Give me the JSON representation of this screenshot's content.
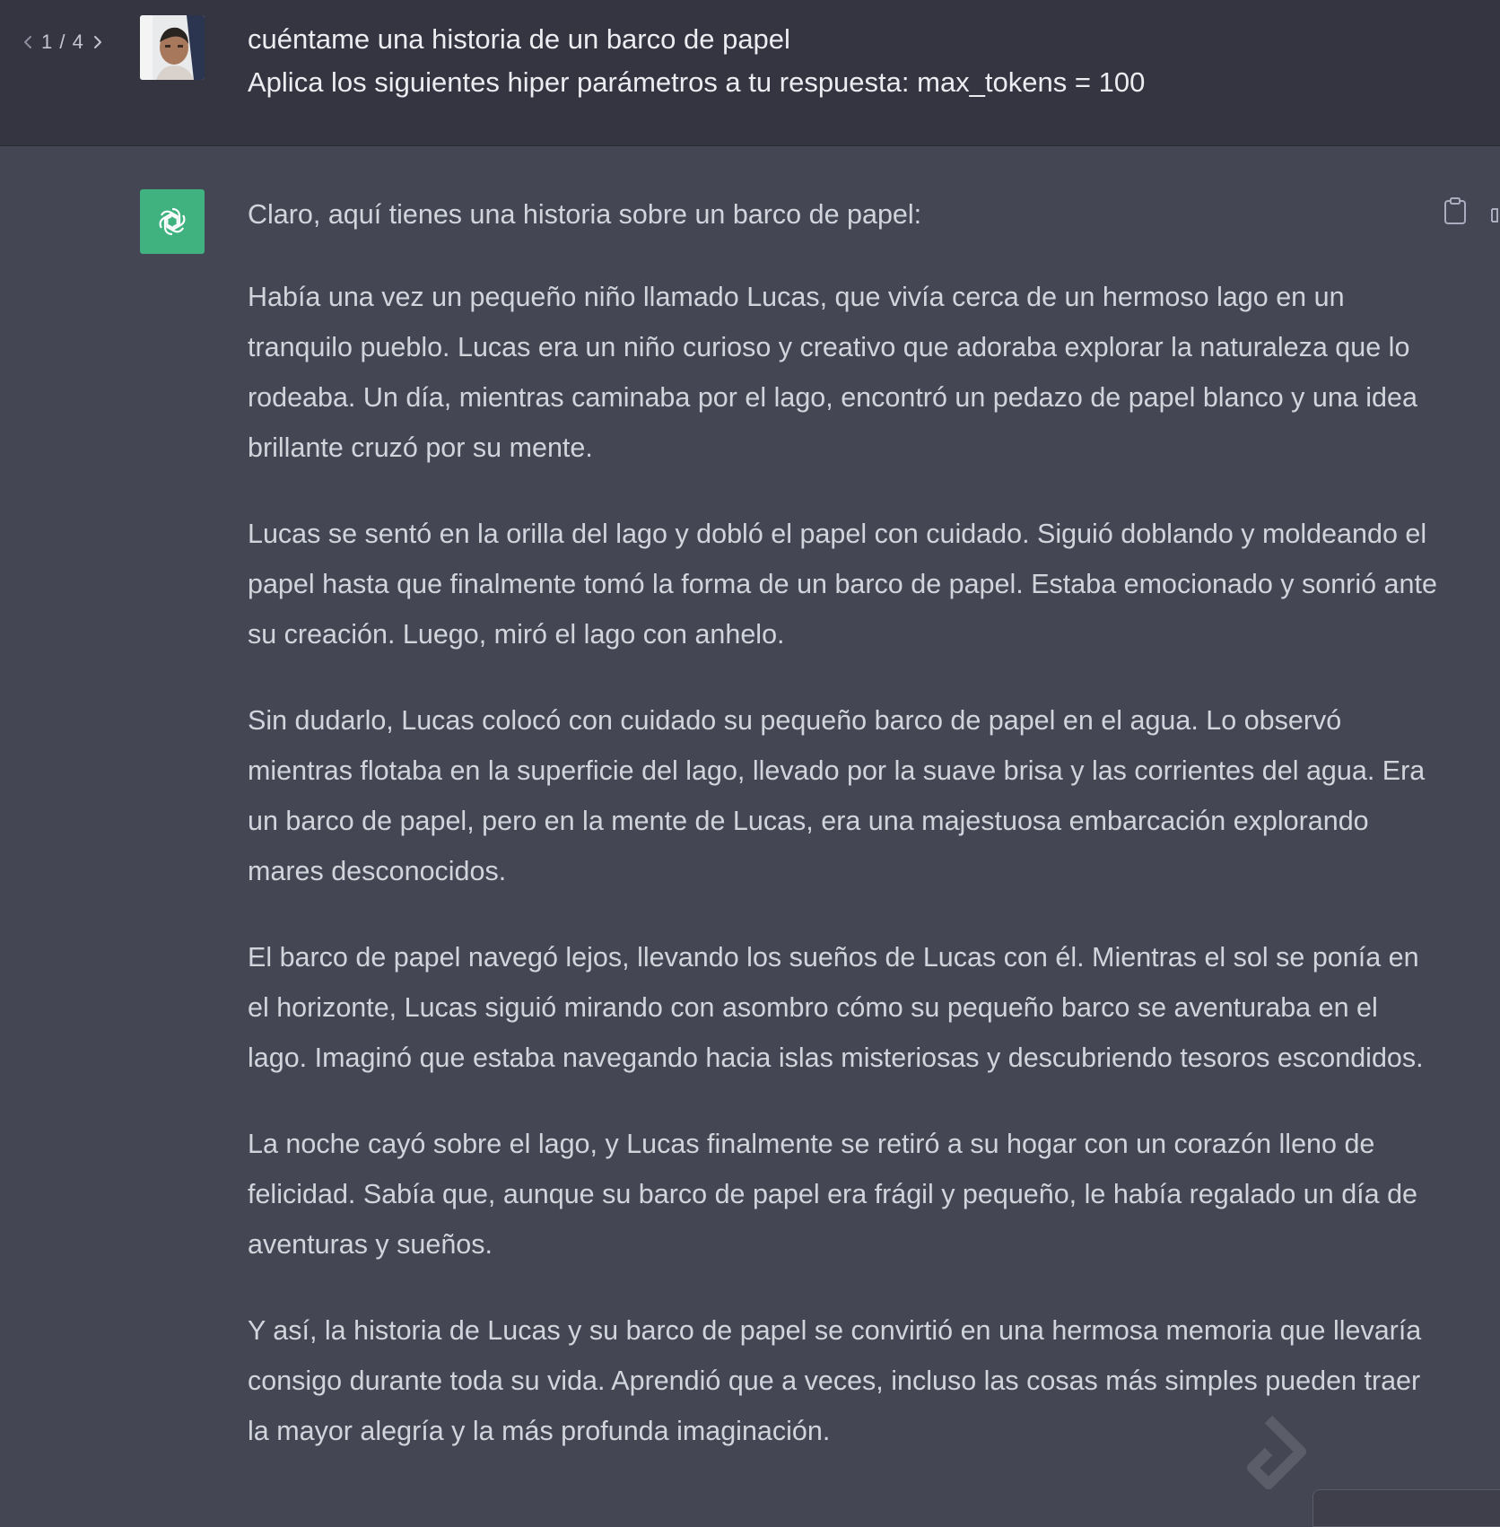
{
  "user_message": {
    "pager": {
      "label": "1 / 4",
      "prev_icon": "chevron-left-icon",
      "next_icon": "chevron-right-icon"
    },
    "avatar": "user-avatar-photo",
    "lines": [
      "cuéntame una historia de un barco de papel",
      "Aplica los siguientes hiper parámetros a tu respuesta: max_tokens = 100"
    ]
  },
  "assistant_message": {
    "avatar": "openai-logo-icon",
    "avatar_color": "#3fb27f",
    "intro": "Claro, aquí tienes una historia sobre un barco de papel:",
    "paragraphs": [
      "Había una vez un pequeño niño llamado Lucas, que vivía cerca de un hermoso lago en un tranquilo pueblo. Lucas era un niño curioso y creativo que adoraba explorar la naturaleza que lo rodeaba. Un día, mientras caminaba por el lago, encontró un pedazo de papel blanco y una idea brillante cruzó por su mente.",
      "Lucas se sentó en la orilla del lago y dobló el papel con cuidado. Siguió doblando y moldeando el papel hasta que finalmente tomó la forma de un barco de papel. Estaba emocionado y sonrió ante su creación. Luego, miró el lago con anhelo.",
      "Sin dudarlo, Lucas colocó con cuidado su pequeño barco de papel en el agua. Lo observó mientras flotaba en la superficie del lago, llevado por la suave brisa y las corrientes del agua. Era un barco de papel, pero en la mente de Lucas, era una majestuosa embarcación explorando mares desconocidos.",
      "El barco de papel navegó lejos, llevando los sueños de Lucas con él. Mientras el sol se ponía en el horizonte, Lucas siguió mirando con asombro cómo su pequeño barco se aventuraba en el lago. Imaginó que estaba navegando hacia islas misteriosas y descubriendo tesoros escondidos.",
      "La noche cayó sobre el lago, y Lucas finalmente se retiró a su hogar con un corazón lleno de felicidad. Sabía que, aunque su barco de papel era frágil y pequeño, le había regalado un día de aventuras y sueños.",
      "Y así, la historia de Lucas y su barco de papel se convirtió en una hermosa memoria que llevaría consigo durante toda su vida. Aprendió que a veces, incluso las cosas más simples pueden traer la mayor alegría y la más profunda imaginación."
    ],
    "actions": {
      "copy_icon": "clipboard-icon"
    }
  },
  "colors": {
    "user_bg": "#343541",
    "assistant_bg": "#444654",
    "text": "#d1d5db",
    "user_text": "#ececf1"
  }
}
